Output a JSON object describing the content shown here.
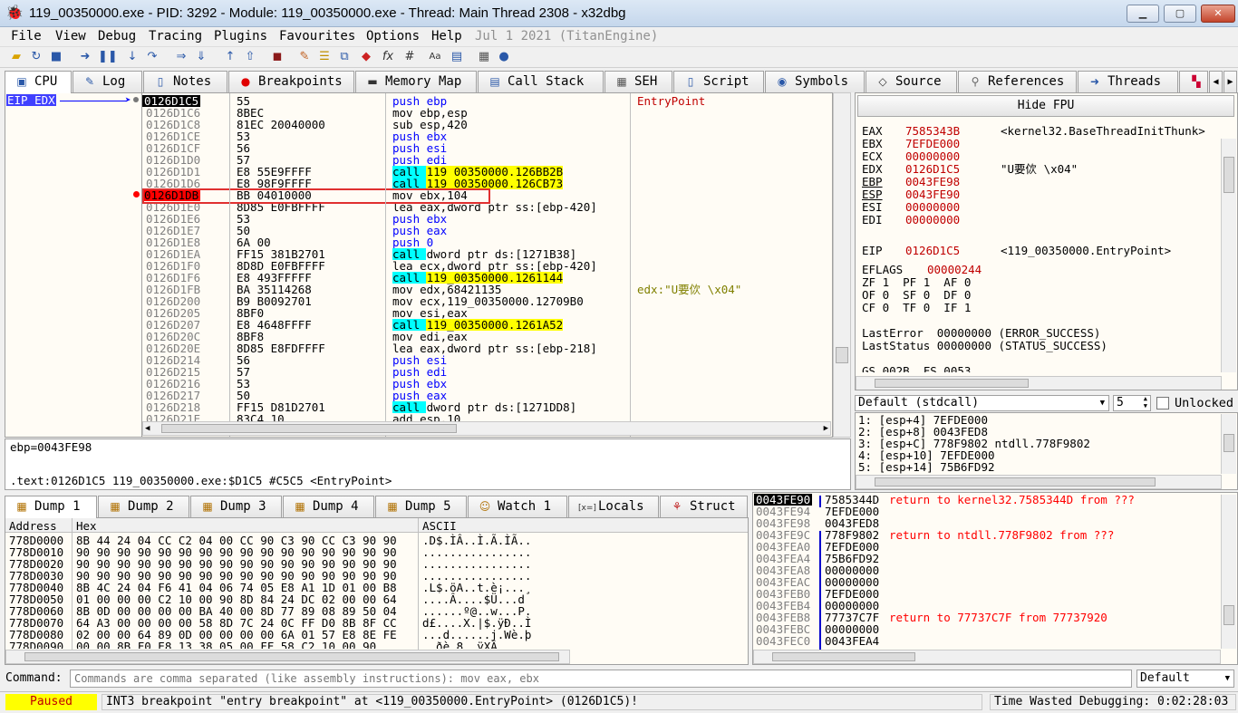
{
  "window": {
    "title": "119_00350000.exe - PID: 3292 - Module: 119_00350000.exe - Thread: Main Thread 2308 - x32dbg",
    "minimize": "▁",
    "maximize": "▢",
    "close": "✕"
  },
  "menu": {
    "items": [
      "File",
      "View",
      "Debug",
      "Tracing",
      "Plugins",
      "Favourites",
      "Options",
      "Help"
    ],
    "version": "Jul 1 2021 (TitanEngine)"
  },
  "tabs": [
    "CPU",
    "Log",
    "Notes",
    "Breakpoints",
    "Memory Map",
    "Call Stack",
    "SEH",
    "Script",
    "Symbols",
    "Source",
    "References",
    "Threads"
  ],
  "cpu": {
    "eip_label": "EIP EDX",
    "disasm": [
      {
        "addr": "0126D1C5",
        "bytes": "55",
        "inst": "push ebp",
        "comment": "EntryPoint",
        "kind": "current"
      },
      {
        "addr": "0126D1C6",
        "bytes": "8BEC",
        "inst": "mov ebp,esp",
        "kind": "mov"
      },
      {
        "addr": "0126D1C8",
        "bytes": "81EC 20040000",
        "inst": "sub esp,420",
        "kind": "sub"
      },
      {
        "addr": "0126D1CE",
        "bytes": "53",
        "inst": "push ebx",
        "kind": "push"
      },
      {
        "addr": "0126D1CF",
        "bytes": "56",
        "inst": "push esi",
        "kind": "push"
      },
      {
        "addr": "0126D1D0",
        "bytes": "57",
        "inst": "push edi",
        "kind": "push"
      },
      {
        "addr": "0126D1D1",
        "bytes": "E8 55E9FFFF",
        "inst": "call 119_00350000.126BB2B",
        "kind": "call"
      },
      {
        "addr": "0126D1D6",
        "bytes": "E8 98F9FFFF",
        "inst": "call 119_00350000.126CB73",
        "kind": "call"
      },
      {
        "addr": "0126D1DB",
        "bytes": "BB 04010000",
        "inst": "mov ebx,104",
        "kind": "bp"
      },
      {
        "addr": "0126D1E0",
        "bytes": "8D85 E0FBFFFF",
        "inst": "lea eax,dword ptr ss:[ebp-420]",
        "kind": "lea"
      },
      {
        "addr": "0126D1E6",
        "bytes": "53",
        "inst": "push ebx",
        "kind": "push"
      },
      {
        "addr": "0126D1E7",
        "bytes": "50",
        "inst": "push eax",
        "kind": "push"
      },
      {
        "addr": "0126D1E8",
        "bytes": "6A 00",
        "inst": "push 0",
        "kind": "push"
      },
      {
        "addr": "0126D1EA",
        "bytes": "FF15 381B2701",
        "inst": "call dword ptr ds:[1271B38]",
        "kind": "callm"
      },
      {
        "addr": "0126D1F0",
        "bytes": "8D8D E0FBFFFF",
        "inst": "lea ecx,dword ptr ss:[ebp-420]",
        "kind": "lea"
      },
      {
        "addr": "0126D1F6",
        "bytes": "E8 493FFFFF",
        "inst": "call 119_00350000.1261144",
        "kind": "call"
      },
      {
        "addr": "0126D1FB",
        "bytes": "BA 35114268",
        "inst": "mov edx,68421135",
        "comment": "edx:\"U要佽 \\x04\"",
        "kind": "mov"
      },
      {
        "addr": "0126D200",
        "bytes": "B9 B0092701",
        "inst": "mov ecx,119_00350000.12709B0",
        "kind": "mov"
      },
      {
        "addr": "0126D205",
        "bytes": "8BF0",
        "inst": "mov esi,eax",
        "kind": "mov"
      },
      {
        "addr": "0126D207",
        "bytes": "E8 4648FFFF",
        "inst": "call 119_00350000.1261A52",
        "kind": "call"
      },
      {
        "addr": "0126D20C",
        "bytes": "8BF8",
        "inst": "mov edi,eax",
        "kind": "mov"
      },
      {
        "addr": "0126D20E",
        "bytes": "8D85 E8FDFFFF",
        "inst": "lea eax,dword ptr ss:[ebp-218]",
        "kind": "lea"
      },
      {
        "addr": "0126D214",
        "bytes": "56",
        "inst": "push esi",
        "kind": "push"
      },
      {
        "addr": "0126D215",
        "bytes": "57",
        "inst": "push edi",
        "kind": "push"
      },
      {
        "addr": "0126D216",
        "bytes": "53",
        "inst": "push ebx",
        "kind": "push"
      },
      {
        "addr": "0126D217",
        "bytes": "50",
        "inst": "push eax",
        "kind": "push"
      },
      {
        "addr": "0126D218",
        "bytes": "FF15 D81D2701",
        "inst": "call dword ptr ds:[1271DD8]",
        "kind": "callm"
      },
      {
        "addr": "0126D21E",
        "bytes": "83C4 10",
        "inst": "add esp,10",
        "kind": "mov"
      }
    ]
  },
  "registers": {
    "hide_fpu": "Hide FPU",
    "lines": [
      {
        "name": "EAX",
        "value": "7585343B",
        "note": "<kernel32.BaseThreadInitThunk>"
      },
      {
        "name": "EBX",
        "value": "7EFDE000",
        "note": ""
      },
      {
        "name": "ECX",
        "value": "00000000",
        "note": ""
      },
      {
        "name": "EDX",
        "value": "0126D1C5",
        "note": "\"U要佽 \\x04\""
      },
      {
        "name": "EBP",
        "value": "0043FE98",
        "note": ""
      },
      {
        "name": "ESP",
        "value": "0043FE90",
        "note": ""
      },
      {
        "name": "ESI",
        "value": "00000000",
        "note": ""
      },
      {
        "name": "EDI",
        "value": "00000000",
        "note": ""
      }
    ],
    "eip": {
      "name": "EIP",
      "value": "0126D1C5",
      "note": "<119_00350000.EntryPoint>"
    },
    "eflags": {
      "name": "EFLAGS",
      "value": "00000244"
    },
    "flags": [
      "ZF 1  PF 1  AF 0",
      "OF 0  SF 0  DF 0",
      "CF 0  TF 0  IF 1"
    ],
    "last_error": "LastError  00000000 (ERROR_SUCCESS)",
    "last_status": "LastStatus 00000000 (STATUS_SUCCESS)",
    "segs": "GS 002B  FS 0053"
  },
  "callconv": {
    "selected": "Default (stdcall)",
    "count": "5",
    "unlocked": "Unlocked",
    "args": [
      "1: [esp+4] 7EFDE000",
      "2: [esp+8] 0043FED8",
      "3: [esp+C] 778F9802 ntdll.778F9802",
      "4: [esp+10] 7EFDE000",
      "5: [esp+14] 75B6FD92"
    ]
  },
  "info": {
    "line1": "ebp=0043FE98",
    "line2": ".text:0126D1C5 119_00350000.exe:$D1C5 #C5C5 <EntryPoint>"
  },
  "dump_tabs": [
    "Dump 1",
    "Dump 2",
    "Dump 3",
    "Dump 4",
    "Dump 5",
    "Watch 1",
    "Locals",
    "Struct"
  ],
  "dump": {
    "headers": {
      "address": "Address",
      "hex": "Hex",
      "ascii": "ASCII"
    },
    "rows": [
      {
        "addr": "778D0000",
        "hex": "8B 44 24 04 CC C2 04 00 CC 90 C3 90 CC C3 90 90",
        "ascii": ".D$.ÌÂ..Ì.Ã.ÌÃ.."
      },
      {
        "addr": "778D0010",
        "hex": "90 90 90 90 90 90 90 90 90 90 90 90 90 90 90 90",
        "ascii": "................"
      },
      {
        "addr": "778D0020",
        "hex": "90 90 90 90 90 90 90 90 90 90 90 90 90 90 90 90",
        "ascii": "................"
      },
      {
        "addr": "778D0030",
        "hex": "90 90 90 90 90 90 90 90 90 90 90 90 90 90 90 90",
        "ascii": "................"
      },
      {
        "addr": "778D0040",
        "hex": "8B 4C 24 04 F6 41 04 06 74 05 E8 A1 1D 01 00 B8",
        "ascii": ".L$.öA..t.è¡...¸"
      },
      {
        "addr": "778D0050",
        "hex": "01 00 00 00 C2 10 00 90 8D 84 24 DC 02 00 00 64",
        "ascii": "....Â....$Ü...d"
      },
      {
        "addr": "778D0060",
        "hex": "8B 0D 00 00 00 00 BA 40 00 8D 77 89 08 89 50 04",
        "ascii": "......º@..w...P."
      },
      {
        "addr": "778D0070",
        "hex": "64 A3 00 00 00 00 58 8D 7C 24 0C FF D0 8B 8F CC",
        "ascii": "d£....X.|$.ÿÐ..Ì"
      },
      {
        "addr": "778D0080",
        "hex": "02 00 00 64 89 0D 00 00 00 00 6A 01 57 E8 8E FE",
        "ascii": "...d......j.Wè.þ"
      },
      {
        "addr": "778D0090",
        "hex": "00 00 8B F0 E8 13 38 05 00 FF 58 C2 10 00 90",
        "ascii": "..ðè.8..ÿXÂ..."
      }
    ]
  },
  "stack": {
    "rows": [
      {
        "addr": "0043FE90",
        "val": "7585344D",
        "cmt": "return to kernel32.7585344D from ???"
      },
      {
        "addr": "0043FE94",
        "val": "7EFDE000",
        "cmt": ""
      },
      {
        "addr": "0043FE98",
        "val": "0043FED8",
        "cmt": ""
      },
      {
        "addr": "0043FE9C",
        "val": "778F9802",
        "cmt": "return to ntdll.778F9802 from ???"
      },
      {
        "addr": "0043FEA0",
        "val": "7EFDE000",
        "cmt": ""
      },
      {
        "addr": "0043FEA4",
        "val": "75B6FD92",
        "cmt": ""
      },
      {
        "addr": "0043FEA8",
        "val": "00000000",
        "cmt": ""
      },
      {
        "addr": "0043FEAC",
        "val": "00000000",
        "cmt": ""
      },
      {
        "addr": "0043FEB0",
        "val": "7EFDE000",
        "cmt": ""
      },
      {
        "addr": "0043FEB4",
        "val": "00000000",
        "cmt": ""
      },
      {
        "addr": "0043FEB8",
        "val": "77737C7F",
        "cmt": "return to 77737C7F from 77737920"
      },
      {
        "addr": "0043FEBC",
        "val": "00000000",
        "cmt": ""
      },
      {
        "addr": "0043FEC0",
        "val": "0043FEA4",
        "cmt": ""
      }
    ]
  },
  "command": {
    "label": "Command:",
    "placeholder": "Commands are comma separated (like assembly instructions): mov eax, ebx",
    "engine": "Default"
  },
  "status": {
    "state": "Paused",
    "message": "INT3 breakpoint \"entry breakpoint\" at <119_00350000.EntryPoint> (0126D1C5)!",
    "time": "Time Wasted Debugging: 0:02:28:03"
  },
  "colors": {
    "paused_bg": "#ffff00",
    "bp_red": "#ff0000",
    "call_bg": "#00ffff",
    "target_bg": "#ffff00"
  }
}
